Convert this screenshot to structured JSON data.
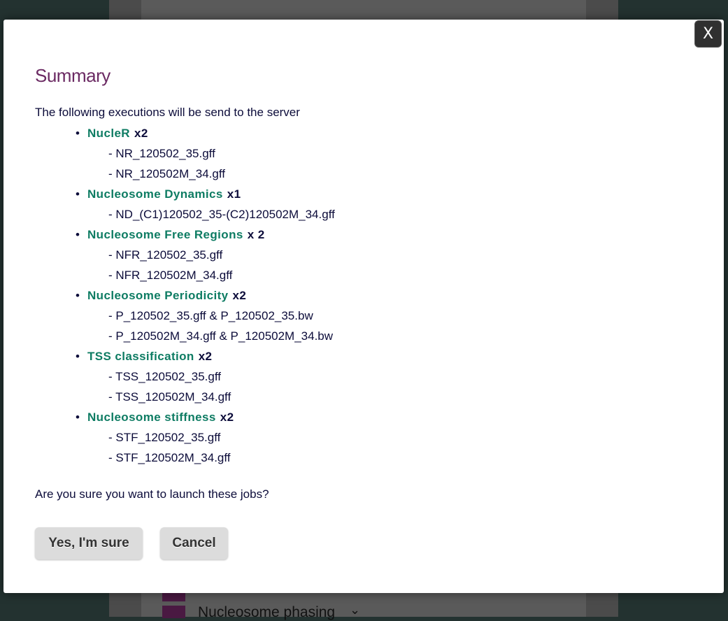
{
  "background": {
    "phasing_label": "Nucleosome phasing",
    "chevron_glyph": "⌄"
  },
  "modal": {
    "close_label": "X",
    "title": "Summary",
    "intro": "The following executions will be send to the server",
    "bullet": "•",
    "file_prefix": "- ",
    "executions": [
      {
        "tool": "NucleR",
        "count": "x2",
        "files": [
          "NR_120502_35.gff",
          "NR_120502M_34.gff"
        ]
      },
      {
        "tool": "Nucleosome Dynamics",
        "count": "x1",
        "files": [
          "ND_(C1)120502_35-(C2)120502M_34.gff"
        ]
      },
      {
        "tool": "Nucleosome Free Regions",
        "count": "x 2",
        "files": [
          "NFR_120502_35.gff",
          "NFR_120502M_34.gff"
        ]
      },
      {
        "tool": "Nucleosome Periodicity",
        "count": "x2",
        "files": [
          "P_120502_35.gff & P_120502_35.bw",
          "P_120502M_34.gff & P_120502M_34.bw"
        ]
      },
      {
        "tool": "TSS classification",
        "count": "x2",
        "files": [
          "TSS_120502_35.gff",
          "TSS_120502M_34.gff"
        ]
      },
      {
        "tool": "Nucleosome stiffness",
        "count": "x2",
        "files": [
          "STF_120502_35.gff",
          "STF_120502M_34.gff"
        ]
      }
    ],
    "question": "Are you sure you want to launch these jobs?",
    "confirm_label": "Yes, I'm sure",
    "cancel_label": "Cancel"
  },
  "colors": {
    "title": "#6b2a63",
    "tool_link": "#0e7c63",
    "text": "#0c0c3a",
    "button_bg": "#dcdcdc"
  }
}
